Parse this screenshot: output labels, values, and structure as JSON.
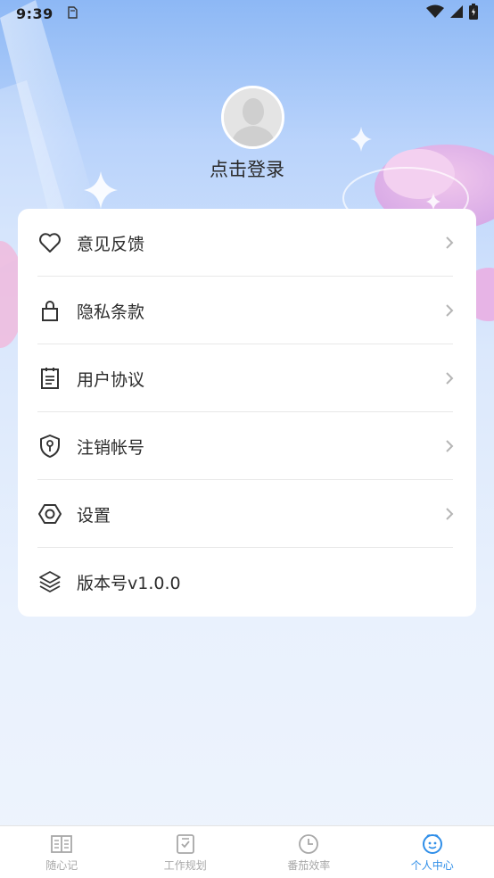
{
  "status_bar": {
    "time": "9:39"
  },
  "profile": {
    "login_label": "点击登录"
  },
  "menu": {
    "items": [
      {
        "label": "意见反馈",
        "icon": "heart-icon",
        "has_arrow": true
      },
      {
        "label": "隐私条款",
        "icon": "lock-icon",
        "has_arrow": true
      },
      {
        "label": "用户协议",
        "icon": "clipboard-icon",
        "has_arrow": true
      },
      {
        "label": "注销帐号",
        "icon": "shield-key-icon",
        "has_arrow": true
      },
      {
        "label": "设置",
        "icon": "hexagon-settings-icon",
        "has_arrow": true
      },
      {
        "label": "版本号v1.0.0",
        "icon": "layers-icon",
        "has_arrow": false
      }
    ]
  },
  "tab_bar": {
    "tabs": [
      {
        "label": "随心记",
        "icon": "book-icon",
        "active": false
      },
      {
        "label": "工作规划",
        "icon": "checklist-icon",
        "active": false
      },
      {
        "label": "番茄效率",
        "icon": "clock-icon",
        "active": false
      },
      {
        "label": "个人中心",
        "icon": "face-icon",
        "active": true
      }
    ]
  },
  "colors": {
    "accent": "#2f8ee8",
    "inactive": "#a8a8a8",
    "text": "#2c2c2c"
  }
}
